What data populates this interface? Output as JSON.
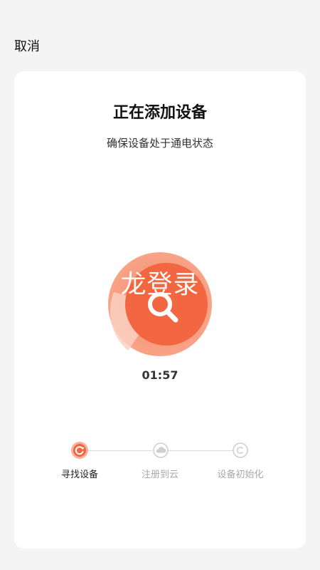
{
  "header": {
    "cancel_label": "取消"
  },
  "card": {
    "title": "正在添加设备",
    "subtitle": "确保设备处于通电状态",
    "watermark": "龙登录",
    "timer": "01:57"
  },
  "steps": [
    {
      "label": "寻找设备",
      "state": "active",
      "icon": "refresh-icon"
    },
    {
      "label": "注册到云",
      "state": "inactive",
      "icon": "cloud-icon"
    },
    {
      "label": "设备初始化",
      "state": "inactive",
      "icon": "copyright-c-icon"
    }
  ],
  "colors": {
    "accent": "#f26641",
    "accent_light": "#f8a387",
    "inactive": "#cfcfcf"
  }
}
